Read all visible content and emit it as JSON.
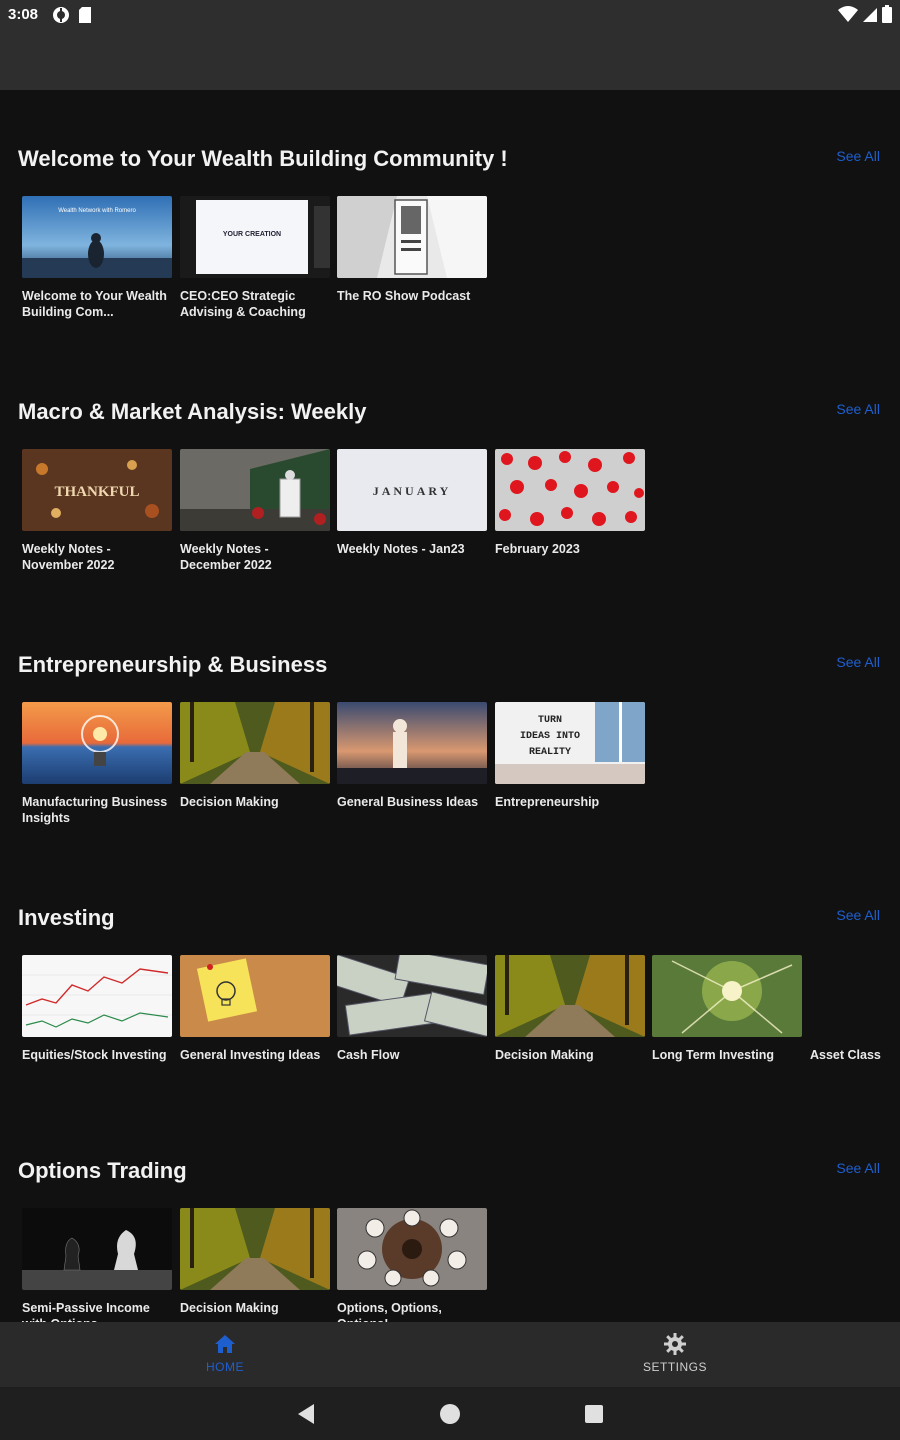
{
  "status_bar": {
    "time": "3:08",
    "left_icons": [
      "app-notification-icon",
      "sd-card-icon"
    ],
    "right_icons": [
      "wifi-icon",
      "signal-icon",
      "battery-icon"
    ]
  },
  "sections": [
    {
      "title": "Welcome to Your Wealth Building Community !",
      "see_all": "See All",
      "cards": [
        {
          "title": "Welcome to Your Wealth Building Com..."
        },
        {
          "title": "CEO:CEO Strategic Advising & Coaching"
        },
        {
          "title": "The RO Show Podcast"
        }
      ]
    },
    {
      "title": "Macro & Market Analysis: Weekly",
      "see_all": "See All",
      "cards": [
        {
          "title": "Weekly Notes - November 2022"
        },
        {
          "title": "Weekly Notes - December 2022"
        },
        {
          "title": "Weekly Notes - Jan23"
        },
        {
          "title": "February 2023"
        }
      ]
    },
    {
      "title": "Entrepreneurship & Business",
      "see_all": "See All",
      "cards": [
        {
          "title": "Manufacturing Business Insights"
        },
        {
          "title": "Decision Making"
        },
        {
          "title": "General Business Ideas"
        },
        {
          "title": "Entrepreneurship"
        }
      ]
    },
    {
      "title": "Investing",
      "see_all": "See All",
      "cards": [
        {
          "title": "Equities/Stock Investing"
        },
        {
          "title": "General Investing Ideas"
        },
        {
          "title": "Cash Flow"
        },
        {
          "title": "Decision Making"
        },
        {
          "title": "Long Term Investing"
        },
        {
          "title": "Asset Class"
        }
      ]
    },
    {
      "title": "Options Trading",
      "see_all": "See All",
      "cards": [
        {
          "title": "Semi-Passive Income with Options"
        },
        {
          "title": "Decision Making"
        },
        {
          "title": "Options, Options, Options!"
        }
      ]
    }
  ],
  "thumb_text": {
    "welcome": "Wealth Network with Romero",
    "creation": "YOUR CREATION",
    "thankful": "THANKFUL",
    "january": "JANUARY",
    "ideas_line1": "TURN",
    "ideas_line2": "IDEAS INTO",
    "ideas_line3": "REALITY"
  },
  "bottom_nav": {
    "home_label": "HOME",
    "settings_label": "SETTINGS",
    "active": "home",
    "active_color": "#1e5fd0",
    "inactive_color": "#cfcfcf"
  },
  "colors": {
    "background": "#111111",
    "accent": "#1e5fd0",
    "app_bar": "#2e2e2e"
  }
}
